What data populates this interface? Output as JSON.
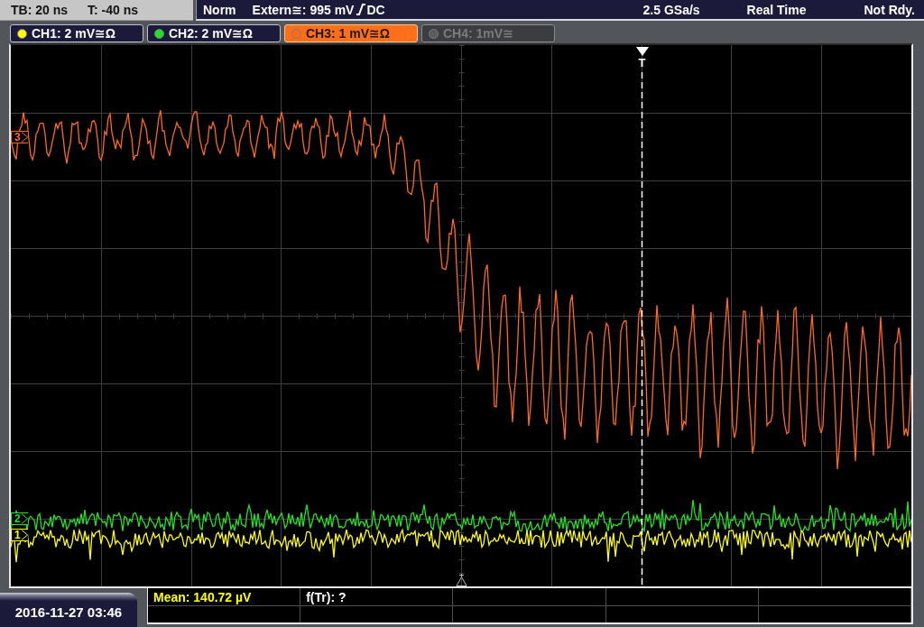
{
  "status_bar": {
    "timebase": "TB: 20 ns",
    "trigger_time": "T: -40 ns",
    "trigger_mode": "Norm",
    "trigger_source": "Extern≅: 995 mV",
    "trigger_coupling": "DC",
    "sample_rate": "2.5 GSa/s",
    "acquisition_mode": "Real Time",
    "state": "Not Rdy."
  },
  "channels": [
    {
      "label": "CH1: 2 mV≅Ω",
      "color": "#ffff00",
      "selected": false,
      "enabled": true
    },
    {
      "label": "CH2: 2 mV≅Ω",
      "color": "#22e022",
      "selected": false,
      "enabled": true
    },
    {
      "label": "CH3: 1 mV≅Ω",
      "color": "#ff6a1a",
      "selected": true,
      "enabled": true
    },
    {
      "label": "CH4: 1mV≅",
      "color": "#5c5c5c",
      "selected": false,
      "enabled": false
    }
  ],
  "display": {
    "trigger_marker": "T",
    "traces": [
      {
        "marker": "3",
        "color": "#ff6a1a",
        "kind": "step"
      },
      {
        "marker": "2",
        "color": "#22e022",
        "kind": "noise"
      },
      {
        "marker": "1",
        "color": "#ffff00",
        "kind": "noise"
      }
    ]
  },
  "date_time": "2016-11-27 03:46",
  "measurements": [
    {
      "text": "Mean: 140.72 µV",
      "color": "#ffff00"
    },
    {
      "text": "f(Tr): ?",
      "color": "#ffffff"
    }
  ]
}
